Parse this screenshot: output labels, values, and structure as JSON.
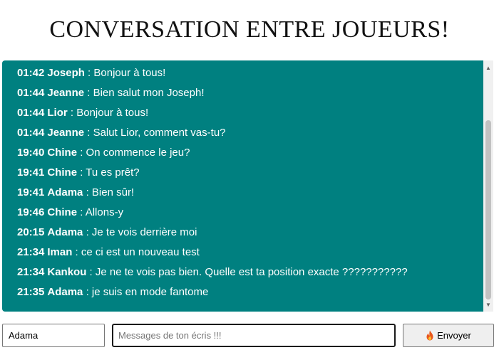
{
  "header": {
    "title": "CONVERSATION ENTRE JOUEURS!"
  },
  "chat": {
    "background_color": "#008080",
    "text_color": "#ffffff",
    "messages": [
      {
        "time": "01:42",
        "user": "Joseph",
        "text": " : Bonjour à tous!"
      },
      {
        "time": "01:44",
        "user": "Jeanne",
        "text": " : Bien salut mon Joseph!"
      },
      {
        "time": "01:44",
        "user": "Lior",
        "text": " : Bonjour à tous!"
      },
      {
        "time": "01:44",
        "user": "Jeanne",
        "text": " : Salut Lior, comment vas-tu?"
      },
      {
        "time": "19:40",
        "user": "Chine",
        "text": " : On commence le jeu?"
      },
      {
        "time": "19:41",
        "user": "Chine",
        "text": " : Tu es prêt?"
      },
      {
        "time": "19:41",
        "user": "Adama",
        "text": " : Bien sûr!"
      },
      {
        "time": "19:46",
        "user": "Chine",
        "text": " : Allons-y"
      },
      {
        "time": "20:15",
        "user": "Adama",
        "text": " : Je te vois derrière moi"
      },
      {
        "time": "21:34",
        "user": "Iman",
        "text": " : ce ci est un nouveau test"
      },
      {
        "time": "21:34",
        "user": "Kankou",
        "text": " : Je ne te vois pas bien. Quelle est ta position exacte ???????????"
      },
      {
        "time": "21:35",
        "user": "Adama",
        "text": " : je suis en mode fantome"
      }
    ]
  },
  "composer": {
    "name_value": "Adama",
    "message_value": "",
    "message_placeholder": "Messages de ton écris !!!",
    "send_label": "Envoyer",
    "send_icon": "fire-icon"
  }
}
